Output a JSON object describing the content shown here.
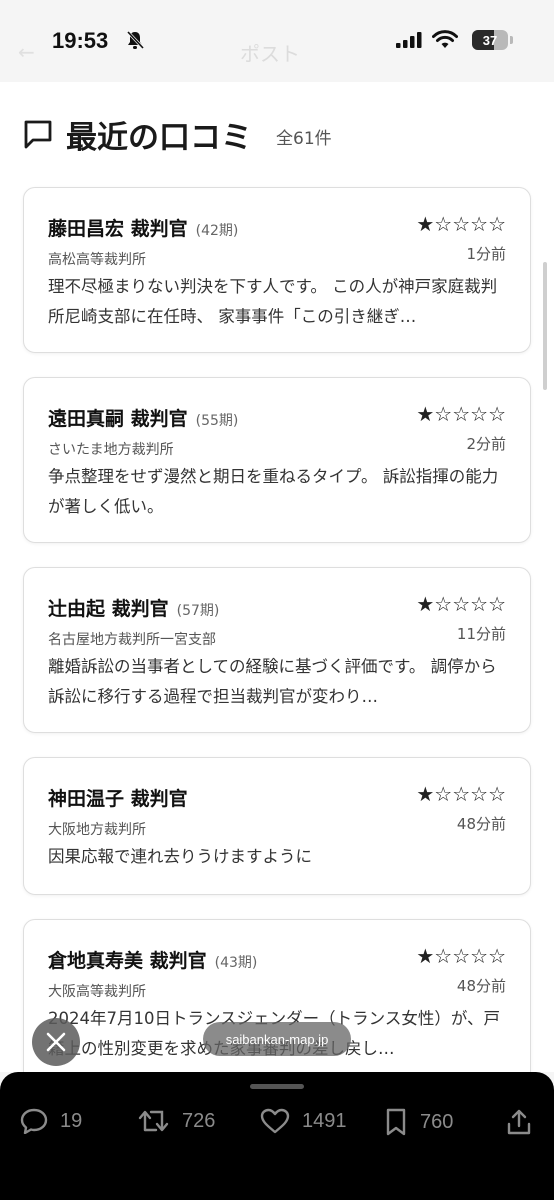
{
  "status_bar": {
    "time": "19:53",
    "battery": "37",
    "faded_title": "ポスト",
    "faded_back": "←"
  },
  "section": {
    "title": "最近の口コミ",
    "count": "全61件"
  },
  "reviews": [
    {
      "name": "藤田昌宏 裁判官",
      "term": "(42期)",
      "court": "高松高等裁判所",
      "rating": 1,
      "stars": "★☆☆☆☆",
      "ago": "1分前",
      "body": "理不尽極まりない判決を下す人です。 この人が神戸家庭裁判所尼崎支部に在任時、 家事事件「この引き継ぎ…"
    },
    {
      "name": "遠田真嗣 裁判官",
      "term": "(55期)",
      "court": "さいたま地方裁判所",
      "rating": 1,
      "stars": "★☆☆☆☆",
      "ago": "2分前",
      "body": "争点整理をせず漫然と期日を重ねるタイプ。 訴訟指揮の能力が著しく低い。"
    },
    {
      "name": "辻由起 裁判官",
      "term": "(57期)",
      "court": "名古屋地方裁判所一宮支部",
      "rating": 1,
      "stars": "★☆☆☆☆",
      "ago": "11分前",
      "body": "離婚訴訟の当事者としての経験に基づく評価です。 調停から訴訟に移行する過程で担当裁判官が変わり…"
    },
    {
      "name": "神田温子 裁判官",
      "term": "",
      "court": "大阪地方裁判所",
      "rating": 1,
      "stars": "★☆☆☆☆",
      "ago": "48分前",
      "body": "因果応報で連れ去りうけますように"
    },
    {
      "name": "倉地真寿美 裁判官",
      "term": "(43期)",
      "court": "大阪高等裁判所",
      "rating": 1,
      "stars": "★☆☆☆☆",
      "ago": "48分前",
      "body": "2024年7月10日トランスジェンダー（トランス女性）が、戸籍上の性別変更を求めた家事審判の差し戻し…"
    }
  ],
  "overlay": {
    "url": "saibankan-map.jp"
  },
  "actions": {
    "replies": "19",
    "reposts": "726",
    "likes": "1491",
    "bookmarks": "760"
  },
  "colors": {
    "star": "#e9b400",
    "bottom_bar": "#000000",
    "action_icon": "#8b8b8b"
  }
}
